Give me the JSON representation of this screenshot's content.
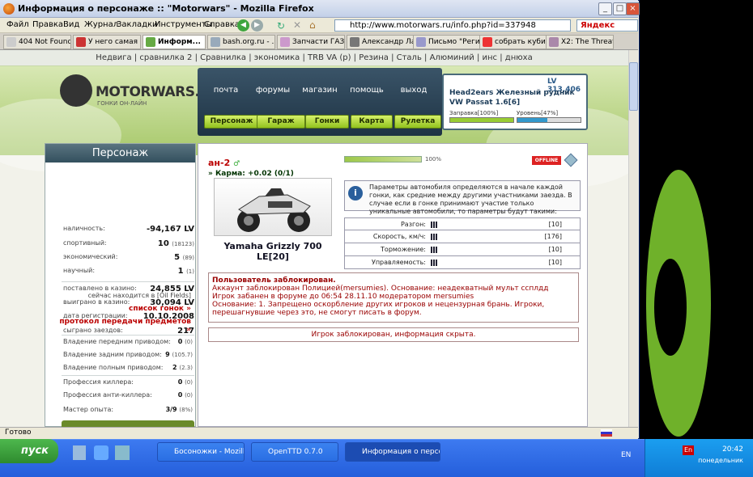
{
  "window": {
    "title": "Информация о персонаже :: \"Motorwars\" - Mozilla Firefox"
  },
  "menu": [
    "Файл",
    "Правка",
    "Вид",
    "Журнал",
    "Закладки",
    "Инструменты",
    "Справка"
  ],
  "url": "http://www.motorwars.ru/info.php?id=337948",
  "search": "Яндекс",
  "tabs": [
    "404 Not Found",
    "У него самая с...",
    "Информ...",
    "bash.org.ru - ...",
    "Запчасти ГАЗ ...",
    "Александр Ла...",
    "Письмо \"Регис...",
    "собрать куби...",
    "X2: The Threat..."
  ],
  "links": "Недвига | сравнилка 2 | Сравнилка | экономика | TRB VA (p) | Резина | Сталь | Алюминий | инс | днюха",
  "site": {
    "logo": "MOTORWARS.RU",
    "logo_sub": "ГОНКИ ОН-ЛАЙН"
  },
  "nav": [
    "почта",
    "форумы",
    "магазин",
    "помощь",
    "выход"
  ],
  "buttons": [
    "Персонаж",
    "Гараж",
    "Гонки",
    "Карта",
    "Рулетка"
  ],
  "info": {
    "lv": "LV 313,406",
    "rudnik": "Head2ears Железный рудник",
    "car": "VW Passat 1.6[6]",
    "fuel": "Заправка[100%]",
    "level": "Уровень[47%]",
    "fuel_pct": 100,
    "level_pct": 47
  },
  "side": {
    "title": "Персонаж",
    "stats": [
      {
        "label": "наличность:",
        "value": "-94,167 LV",
        "extra": ""
      },
      {
        "label": "спортивный:",
        "value": "10",
        "extra": "(18123)"
      },
      {
        "label": "экономический:",
        "value": "5",
        "extra": "(89)"
      },
      {
        "label": "научный:",
        "value": "1",
        "extra": "(1)"
      },
      {
        "label": "поставлено в казино:",
        "value": "24,855 LV",
        "extra": ""
      },
      {
        "label": "выиграно в казино:",
        "value": "30,094 LV",
        "extra": ""
      },
      {
        "label": "дата регистрации:",
        "value": "10.10.2008",
        "extra": ""
      },
      {
        "label": "сыграно заездов:",
        "value": "217",
        "extra": ""
      }
    ],
    "location": "сейчас находится в [Oil Fields]",
    "link1": "список гонок »",
    "link2": "протокол передачи предметов »",
    "drive": [
      {
        "label": "Владение передним приводом:",
        "value": "0",
        "extra": "(0)"
      },
      {
        "label": "Владение задним приводом:",
        "value": "9",
        "extra": "(105.7)"
      },
      {
        "label": "Владение полным приводом:",
        "value": "2",
        "extra": "(2.3)"
      },
      {
        "label": "Профессия киллера:",
        "value": "0",
        "extra": "(0)"
      },
      {
        "label": "Профессия анти-киллера:",
        "value": "0",
        "extra": "(0)"
      },
      {
        "label": "Мастер опыта:",
        "value": "3/9",
        "extra": "(8%)"
      }
    ]
  },
  "main": {
    "nick": "ан-2",
    "karma": "» Карма: +0.02 (0/1)",
    "progress_text": "100%",
    "progress": 100,
    "offline": "OFFLINE",
    "carname": "Yamaha Grizzly 700 LE[20]",
    "notice": "Параметры автомобиля определяются в начале каждой гонки, как средние между другими участниками заезда. В случае если в гонке принимают участие только уникальные автомобили, то параметры будут такими:",
    "specs": [
      {
        "label": "Разгон:",
        "value": "[10]"
      },
      {
        "label": "Скорость, км/ч:",
        "value": "[176]"
      },
      {
        "label": "Торможение:",
        "value": "[10]"
      },
      {
        "label": "Управляемость:",
        "value": "[10]"
      }
    ],
    "ban_title": "Пользователь заблокирован.",
    "ban_l1": "Аккаунт заблокирован Полицией(mersumies). Основание: неадекватный мульт ссплдд",
    "ban_l2": "Игрок забанен в форуме до 06:54 28.11.10 модератором mersumies",
    "ban_l3": "Основание: 1. Запрещено оскорбление других игроков и нецензурная брань. Игроки, перешагнувшие через это, не смогут писать в форум.",
    "hidden": "Игрок заблокирован, информация скрыта."
  },
  "status": "Готово",
  "taskbar": {
    "start": "пуск",
    "tasks": [
      "Босоножки - Mozilla ...",
      "OpenTTD 0.7.0",
      "Информация о персо..."
    ],
    "lang": "EN",
    "time": "20:42",
    "day": "понедельник"
  }
}
